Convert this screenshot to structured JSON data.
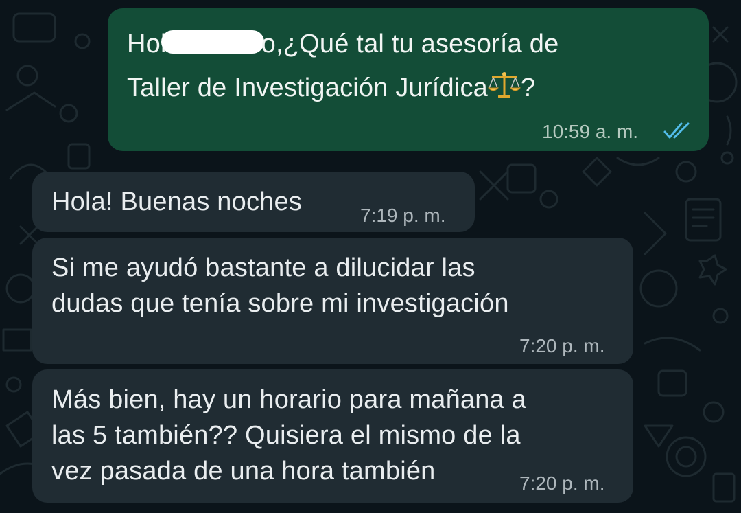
{
  "messages": [
    {
      "direction": "outgoing",
      "line1_start": "Hol",
      "line1_end": "o,¿Qué tal tu asesoría de",
      "line2_text": "Taller de Investigación Jurídica",
      "line2_after_icon": "?",
      "inline_icon": "balance-scale-emoji",
      "time": "10:59 a. m.",
      "status_icon": "double-check-read-icon",
      "status_color": "#53bdeb"
    },
    {
      "direction": "incoming",
      "lines": [
        "Hola! Buenas noches"
      ],
      "time": "7:19 p. m."
    },
    {
      "direction": "incoming",
      "lines": [
        "Si me ayudó bastante a dilucidar las",
        "dudas que tenía sobre mi investigación"
      ],
      "time": "7:20 p. m."
    },
    {
      "direction": "incoming",
      "lines": [
        "Más bien, hay un horario para mañana a",
        "las 5 también?? Quisiera el mismo de la",
        "vez pasada de una hora también"
      ],
      "time": "7:20 p. m."
    }
  ],
  "colors": {
    "background": "#0b141a",
    "outgoing_bubble": "#134d37",
    "incoming_bubble": "#202c33",
    "read_ticks": "#53bdeb"
  }
}
